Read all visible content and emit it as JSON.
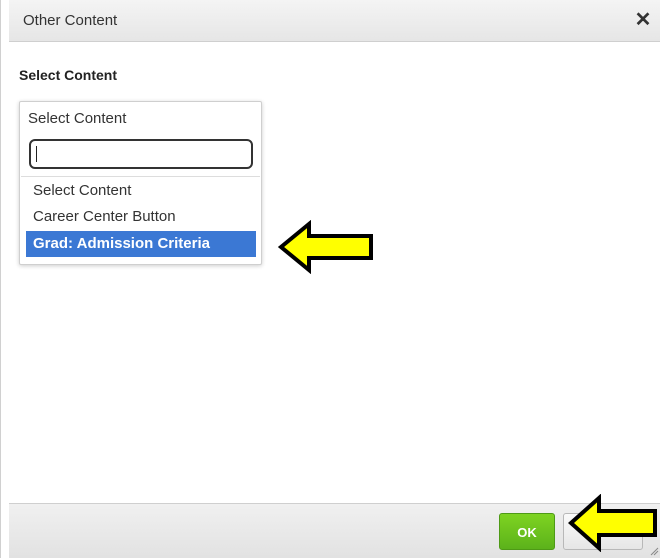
{
  "dialog": {
    "title": "Other Content",
    "close_symbol": "✕"
  },
  "content": {
    "section_label": "Select Content",
    "dropdown": {
      "current_value": "Select Content",
      "search_value": "",
      "options": [
        {
          "label": "Select Content",
          "selected": false
        },
        {
          "label": "Career Center Button",
          "selected": false
        },
        {
          "label": "Grad: Admission Criteria",
          "selected": true
        }
      ]
    }
  },
  "footer": {
    "ok_label": "OK",
    "cancel_label": ""
  },
  "annotations": {
    "arrow_color": "#ffff00",
    "arrow_outline": "#000000",
    "arrow_icon": "left-arrow-icon"
  },
  "colors": {
    "selected_option_bg": "#3b78d4",
    "ok_button": "#6cc31f"
  }
}
